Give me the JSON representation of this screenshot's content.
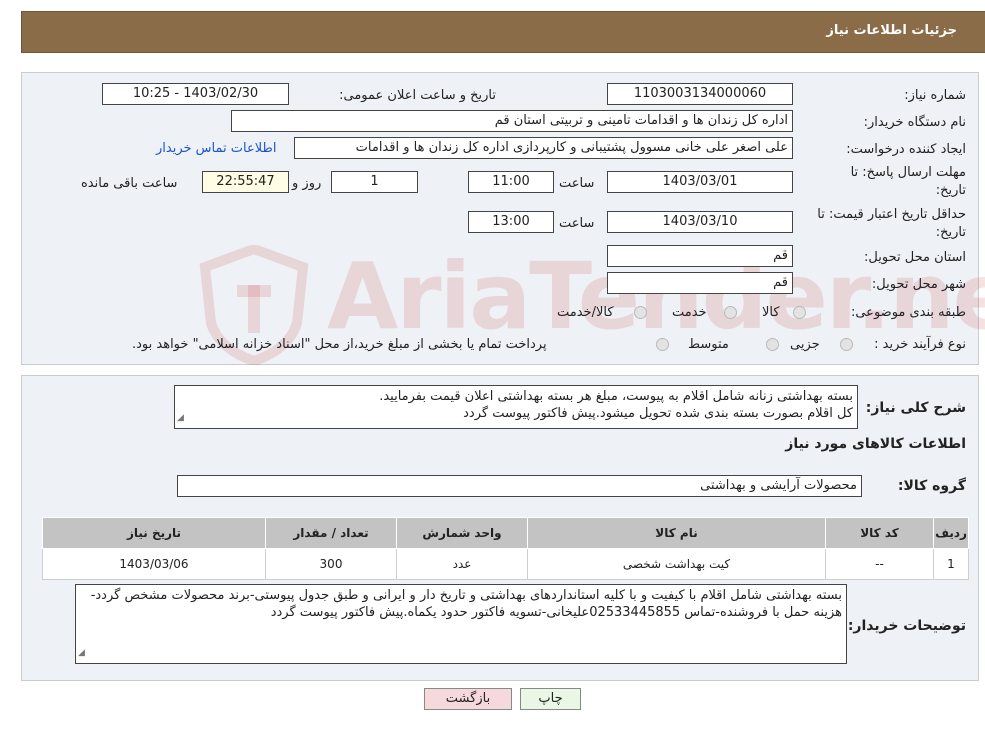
{
  "header": {
    "title": "جزئیات اطلاعات نیاز"
  },
  "form": {
    "need_number_label": "شماره نیاز:",
    "need_number": "1103003134000060",
    "announce_label": "تاریخ و ساعت اعلان عمومی:",
    "announce_value": "1403/02/30 - 10:25",
    "buyer_label": "نام دستگاه خریدار:",
    "buyer_value": "اداره کل زندان ها و اقدامات تامینی و تربیتی استان قم",
    "creator_label": "ایجاد کننده درخواست:",
    "creator_value": "علی اصغر علی خانی مسوول پشتیبانی و کارپردازی اداره کل زندان ها و اقدامات",
    "contact_link": "اطلاعات تماس خریدار",
    "deadline_label_1": "مهلت ارسال پاسخ: تا",
    "deadline_label_2": "تاریخ:",
    "deadline_date": "1403/03/01",
    "hour_label": "ساعت",
    "deadline_time": "11:00",
    "days_value": "1",
    "days_label": "روز و",
    "remaining_value": "22:55:47",
    "remaining_label": "ساعت باقی مانده",
    "price_validity_label_1": "حداقل تاریخ اعتبار قیمت: تا",
    "price_validity_label_2": "تاریخ:",
    "price_validity_date": "1403/03/10",
    "price_validity_time": "13:00",
    "province_label": "استان محل تحویل:",
    "province_value": "قم",
    "city_label": "شهر محل تحویل:",
    "city_value": "قم",
    "category_label": "طبقه بندی موضوعی:",
    "category_options": [
      "کالا",
      "خدمت",
      "کالا/خدمت"
    ],
    "process_label": "نوع فرآیند خرید :",
    "process_options": [
      "جزیی",
      "متوسط"
    ],
    "process_note": "پرداخت تمام یا بخشی از مبلغ خرید،از محل \"اسناد خزانه اسلامی\" خواهد بود."
  },
  "description": {
    "label": "شرح کلی نیاز:",
    "line1": "بسته بهداشتی زنانه شامل اقلام به پیوست، مبلغ هر بسته بهداشتی اعلان قیمت بفرمایید.",
    "line2": "کل اقلام بصورت بسته بندی شده تحویل میشود.پیش فاکتور پیوست گردد"
  },
  "goods": {
    "section_title": "اطلاعات کالاهای مورد نیاز",
    "group_label": "گروه کالا:",
    "group_value": "محصولات آرایشی و بهداشتی",
    "columns": [
      "ردیف",
      "کد کالا",
      "نام کالا",
      "واحد شمارش",
      "تعداد / مقدار",
      "تاریخ نیاز"
    ],
    "rows": [
      {
        "row": "1",
        "code": "--",
        "name": "کیت بهداشت شخصی",
        "unit": "عدد",
        "qty": "300",
        "date": "1403/03/06"
      }
    ]
  },
  "buyer_notes": {
    "label": "توضیحات خریدار:",
    "text": "بسته بهداشتی شامل اقلام با کیفیت و با کلیه استانداردهای بهداشتی و تاریخ دار و ایرانی و طبق جدول پیوستی-برند محصولات مشخص گردد-هزینه حمل با فروشنده-تماس 02533445855علیخانی-تسویه فاکتور حدود یکماه.پیش فاکتور پیوست گردد"
  },
  "buttons": {
    "print": "چاپ",
    "back": "بازگشت"
  },
  "watermark": "AriaTender.neT",
  "colors": {
    "header": "#8a6c48",
    "panel": "#eef1f5",
    "link": "#1a55d0"
  }
}
